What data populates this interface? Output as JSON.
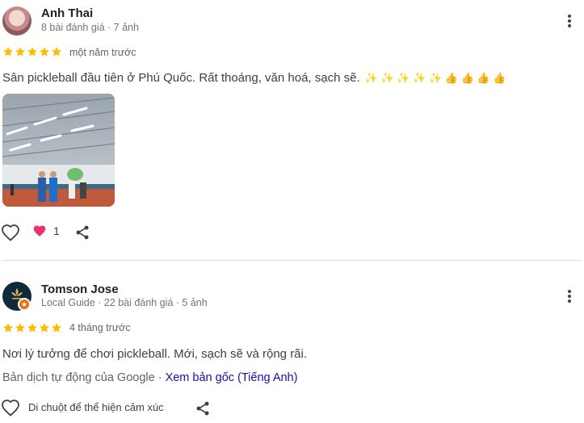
{
  "reviews": [
    {
      "name": "Anh Thai",
      "meta": "8 bài đánh giá · 7 ảnh",
      "rating": 5,
      "when": "một năm trước",
      "text": "Sân pickleball đầu tiên ở Phú Quốc. Rất thoáng, văn hoá, sạch sẽ.",
      "emojis": "✨ ✨ ✨ ✨ ✨ 👍 👍 👍 👍",
      "likes": "1",
      "icons": {
        "more": "more-vert-icon",
        "like": "heart-outline-icon",
        "reaction": "heart-filled-icon",
        "share": "share-icon"
      }
    },
    {
      "name": "Tomson Jose",
      "meta": "Local Guide · 22 bài đánh giá · 5 ảnh",
      "rating": 5,
      "when": "4 tháng trước",
      "text": "Nơi lý tưởng để chơi pickleball. Mới, sạch sẽ và rộng rãi.",
      "translation_note": "Bản dịch tự động của Google · ",
      "translation_link": "Xem bản gốc (Tiếng Anh)",
      "react_hint": "Di chuột để thể hiện cảm xúc",
      "icons": {
        "more": "more-vert-icon",
        "like": "heart-outline-icon",
        "share": "share-icon",
        "badge": "local-guide-star-icon"
      }
    }
  ],
  "colors": {
    "star": "#fbbc04",
    "link": "#1a0dab",
    "heart": "#e8336f",
    "badge": "#e8710a",
    "divider": "#dadce0"
  }
}
